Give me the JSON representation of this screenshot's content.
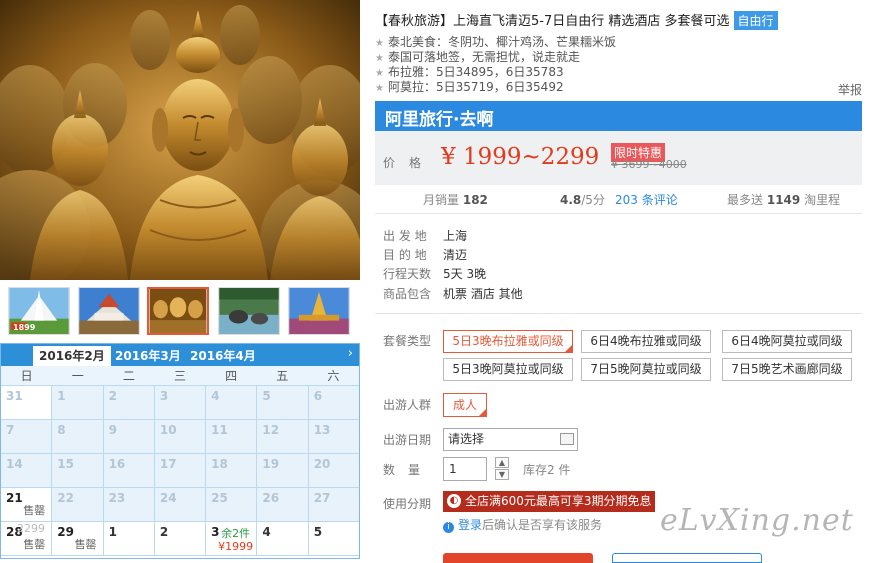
{
  "gallery": {
    "thumbs": [
      {
        "name": "white-temple-thumb",
        "price": "1899"
      },
      {
        "name": "marble-temple-thumb"
      },
      {
        "name": "golden-buddhas-thumb"
      },
      {
        "name": "elephants-thumb"
      },
      {
        "name": "golden-pagoda-thumb"
      }
    ]
  },
  "calendar": {
    "tabs": [
      "2016年2月",
      "2016年3月",
      "2016年4月"
    ],
    "next": "›",
    "weekdays": [
      "日",
      "一",
      "二",
      "三",
      "四",
      "五",
      "六"
    ],
    "rows": [
      [
        {
          "d": "31"
        },
        {
          "d": "1"
        },
        {
          "d": "2"
        },
        {
          "d": "3"
        },
        {
          "d": "4"
        },
        {
          "d": "5"
        },
        {
          "d": "6"
        }
      ],
      [
        {
          "d": "7"
        },
        {
          "d": "8"
        },
        {
          "d": "9"
        },
        {
          "d": "10"
        },
        {
          "d": "11"
        },
        {
          "d": "12"
        },
        {
          "d": "13"
        }
      ],
      [
        {
          "d": "14"
        },
        {
          "d": "15"
        },
        {
          "d": "16"
        },
        {
          "d": "17"
        },
        {
          "d": "18"
        },
        {
          "d": "19"
        },
        {
          "d": "20"
        }
      ],
      [
        {
          "d": "21",
          "note": "售罄"
        },
        {
          "d": "22"
        },
        {
          "d": "23"
        },
        {
          "d": "24"
        },
        {
          "d": "25"
        },
        {
          "d": "26"
        },
        {
          "d": "27"
        }
      ],
      [
        {
          "d": "28",
          "faint": "2299",
          "note": "售罄"
        },
        {
          "d": "29",
          "note": "售罄"
        },
        {
          "d": "1"
        },
        {
          "d": "2"
        },
        {
          "d": "3",
          "avail": "余2件",
          "price": "¥1999"
        },
        {
          "d": "4"
        },
        {
          "d": "5"
        }
      ]
    ]
  },
  "product": {
    "title": "【春秋旅游】上海直飞清迈5-7日自由行 精选酒店 多套餐可选",
    "badge": "自由行",
    "features": [
      "泰北美食：冬阴功、椰汁鸡汤、芒果糯米饭",
      "泰国可落地签，无需担忧，说走就走",
      "布拉雅：5日34895，6日35783",
      "阿莫拉：5日35719，6日35492"
    ],
    "report": "举报",
    "brand": "阿里旅行·去啊",
    "price_label": "价格",
    "price": "¥ 1999~2299",
    "sale_tag": "限时特惠",
    "orig_price": "¥ 3699~4000",
    "stats": {
      "sales_label": "月销量",
      "sales": "182",
      "rating": "4.8",
      "rating_suffix": "/5分",
      "reviews": "203 条评论",
      "miles_label": "最多送",
      "miles": "1149",
      "miles_suffix": "淘里程"
    },
    "info": [
      {
        "label": "出 发 地",
        "value": "上海"
      },
      {
        "label": "目 的 地",
        "value": "清迈"
      },
      {
        "label": "行程天数",
        "value": "5天 3晚"
      },
      {
        "label": "商品包含",
        "value": "机票  酒店  其他"
      }
    ]
  },
  "options": {
    "package_label": "套餐类型",
    "packages": [
      "5日3晚布拉雅或同级",
      "6日4晚布拉雅或同级",
      "6日4晚阿莫拉或同级",
      "5日3晚阿莫拉或同级",
      "7日5晚阿莫拉或同级",
      "7日5晚艺术画廊同级"
    ],
    "selected_package": 0,
    "crowd_label": "出游人群",
    "crowd": "成人",
    "date_label": "出游日期",
    "date_placeholder": "请选择",
    "qty_label": "数量",
    "qty": "1",
    "stock": "库存2 件",
    "installment_label": "使用分期",
    "installment_promo": "全店满600元最高可享3期分期免息",
    "login_link": "登录",
    "login_note": "后确认是否享有该服务"
  },
  "watermark": "eLvXing.net"
}
